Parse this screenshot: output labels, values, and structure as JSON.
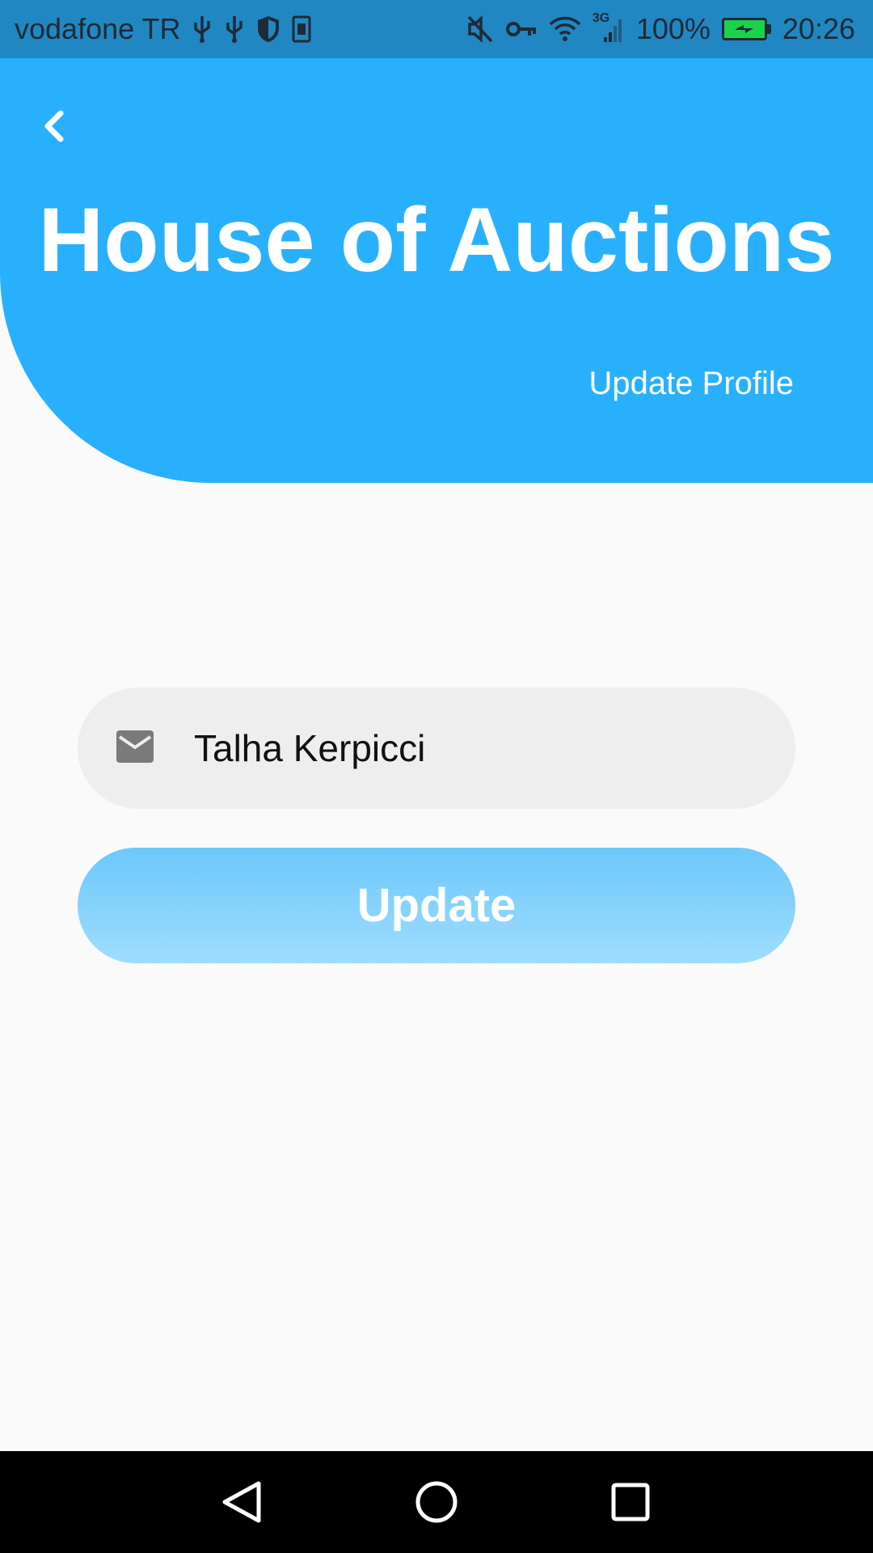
{
  "status_bar": {
    "carrier": "vodafone TR",
    "network_label": "3G",
    "battery": "100%",
    "time": "20:26",
    "icons_left": [
      "usb-icon",
      "usb-icon",
      "shield-icon",
      "sim-card-icon"
    ],
    "icons_right": [
      "mute-icon",
      "vpn-key-icon",
      "wifi-icon",
      "signal-icon",
      "battery-charging-icon"
    ],
    "battery_color": "#19d34a"
  },
  "header": {
    "title": "House of Auctions",
    "subtitle": "Update Profile",
    "background_color": "#29b0fd"
  },
  "form": {
    "name_field": {
      "value": "Talha Kerpicci",
      "icon": "mail-icon"
    },
    "submit_label": "Update"
  },
  "nav_bar": {
    "buttons": [
      "back-icon",
      "home-icon",
      "recents-icon"
    ]
  },
  "colors": {
    "status_bar": "#2187c3",
    "accent": "#29b0fd",
    "page_background": "#fafafa",
    "input_background": "#eeeeee"
  }
}
